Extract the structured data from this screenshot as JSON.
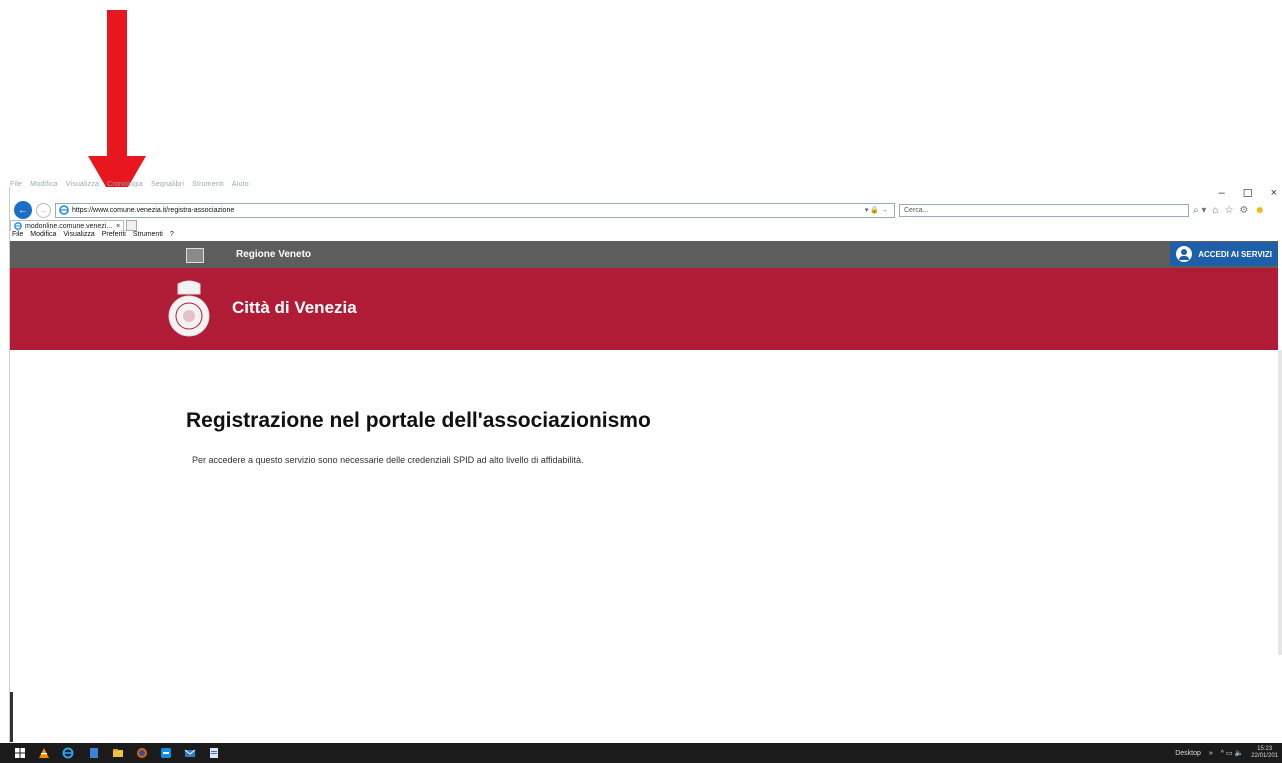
{
  "ghost_menu": [
    "File",
    "Modifica",
    "Visualizza",
    "Cronologia",
    "Segnalibri",
    "Strumenti",
    "Aiuto"
  ],
  "window_controls": [
    "–",
    "☐",
    "×"
  ],
  "browser": {
    "url": "https://www.comune.venezia.it/registra-associazione",
    "url_tools": "▾ 🔒 →",
    "search_placeholder": "Cerca...",
    "search_icon": "⌕ ▾",
    "right_icons": [
      "home-icon",
      "star-icon",
      "gear-icon",
      "smiley-icon"
    ],
    "tab_title": "modonline.comune.venezi...",
    "tab_close": "×",
    "menu": [
      "File",
      "Modifica",
      "Visualizza",
      "Preferiti",
      "Strumenti",
      "?"
    ]
  },
  "page": {
    "region_label": "Regione Veneto",
    "login_button": "ACCEDI AI SERVIZI",
    "city_name": "Città di Venezia",
    "title": "Registrazione nel portale dell'associazionismo",
    "description": "Per accedere a questo servizio sono necessarie delle credenziali SPID ad alto livello di affidabilità."
  },
  "colors": {
    "header_red": "#b01c35",
    "topbar_gray": "#5d5d5d",
    "accent_blue": "#1d5fa8",
    "arrow_red": "#e8161e"
  },
  "taskbar": {
    "icons": [
      "windows-start-icon",
      "vlc-icon",
      "internet-explorer-icon",
      "file-icon",
      "file-explorer-icon",
      "firefox-icon",
      "teamviewer-icon",
      "mail-icon",
      "document-icon"
    ],
    "desktop_label": "Desktop",
    "tray_chevron": "»",
    "tray_icons": "^ ▭ 🔈",
    "time": "15:23",
    "date": "22/01/201"
  }
}
